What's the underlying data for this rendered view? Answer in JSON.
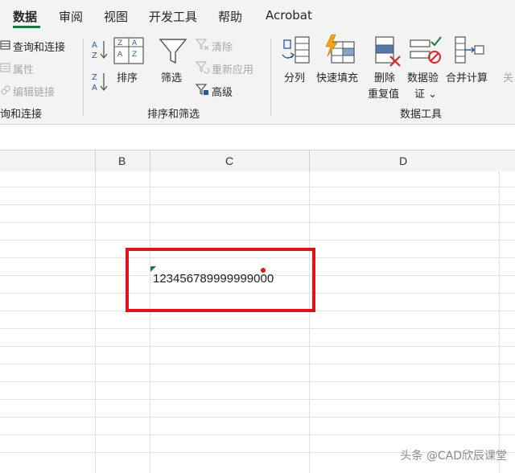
{
  "tabs": [
    "数据",
    "审阅",
    "视图",
    "开发工具",
    "帮助",
    "Acrobat"
  ],
  "active_tab": "数据",
  "ribbon": {
    "connections": {
      "items": [
        "查询和连接",
        "属性",
        "编辑链接"
      ],
      "group_label": "询和连接"
    },
    "sort_filter": {
      "sort_asc_label": "A↓Z",
      "sort_desc_label": "Z↓A",
      "sort": "排序",
      "filter": "筛选",
      "clear": "清除",
      "reapply": "重新应用",
      "advanced": "高级",
      "group_label": "排序和筛选"
    },
    "data_tools": {
      "split": "分列",
      "flash_fill": "快速填充",
      "remove_dup_line1": "删除",
      "remove_dup_line2": "重复值",
      "validation_line1": "数据验",
      "validation_line2": "证 ⌄",
      "consolidate": "合并计算",
      "relations_partial": "关",
      "group_label": "数据工具"
    }
  },
  "columns": [
    "B",
    "C",
    "D"
  ],
  "cell": {
    "value": "123456789999999000"
  },
  "watermark": "头条 @CAD欣辰课堂",
  "colors": {
    "accent": "#217346",
    "highlight": "#e0131a",
    "error_triangle": "#1e7a3a"
  }
}
